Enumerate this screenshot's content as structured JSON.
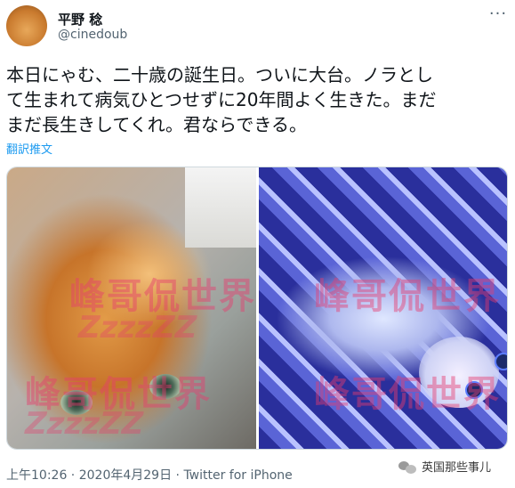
{
  "author": {
    "display_name": "平野 稔",
    "handle": "@cinedoub"
  },
  "more_menu": "···",
  "tweet": {
    "text": "本日にゃむ、二十歳の誕生日。ついに大台。ノラとし\nて生まれて病気ひとつせずに20年間よく生きた。まだ\nまだ長生きしてくれ。君ならできる。",
    "translate_label": "翻訳推文"
  },
  "media": {
    "watermark_brand": "峰哥侃世界",
    "watermark_sub": "ZzzzZZ"
  },
  "meta": {
    "time": "上午10:26",
    "separator": " · ",
    "date": "2020年4月29日",
    "source": "Twitter for iPhone"
  },
  "source_badge": {
    "label": "英国那些事儿"
  },
  "colors": {
    "link": "#1d9bf0",
    "secondary_text": "#536471",
    "watermark": "#e63c6e"
  },
  "icons": {
    "more": "more-horizontal-icon",
    "wechat": "wechat-icon"
  }
}
